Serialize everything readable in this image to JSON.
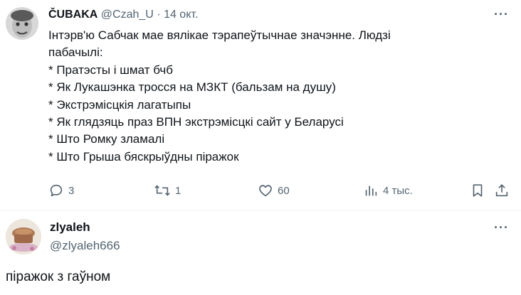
{
  "post": {
    "author_name": "ČUBAKA",
    "author_handle": "@Czah_U",
    "separator": "·",
    "date": "14 окт.",
    "more_label": "···",
    "text_lines": [
      "Інтэрв'ю Сабчак мае вялікае тэрапеўтычнае значэнне. Людзі",
      "пабачылі:",
      "* Пратэсты і шмат бчб",
      "* Як Лукашэнка тросся на МЗКТ (бальзам на душу)",
      "* Экстрэмісцкія лагатыпы",
      "* Як глядзяць праз ВПН экстрэмісцкі сайт у Беларусі",
      "* Што Ромку зламалі",
      "* Што Грыша бяскрыўдны піражок"
    ],
    "actions": {
      "reply_icon": "reply-icon",
      "reply_count": "3",
      "repost_icon": "repost-icon",
      "repost_count": "1",
      "like_icon": "heart-icon",
      "like_count": "60",
      "views_icon": "views-icon",
      "views_count": "4 тыс.",
      "bookmark_icon": "bookmark-icon",
      "share_icon": "share-icon"
    }
  },
  "reply": {
    "author_name": "zlyaleh",
    "author_handle": "@zlyaleh666",
    "more_label": "···",
    "text": "піражок з гаўном"
  },
  "colors": {
    "text": "#0f1419",
    "secondary": "#536471",
    "divider": "#eff3f4"
  }
}
